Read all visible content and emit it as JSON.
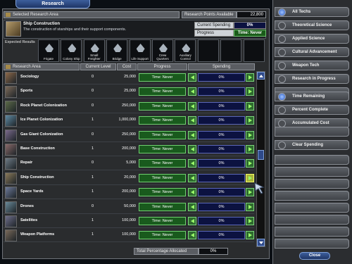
{
  "window": {
    "title": "Research"
  },
  "header": {
    "selected_area_label": "Selected Research Area",
    "rp_label": "Research Points Available",
    "rp_value": "22,800"
  },
  "selected": {
    "name": "Ship Construction",
    "description": "The construction of starships and their support components.",
    "current_spending_label": "Current Spending",
    "current_spending_value": "0%",
    "progress_label": "Progress",
    "progress_value": "Time: Never",
    "expected_results_label": "Expected Results",
    "results": [
      "Frigate",
      "Colony Ship",
      "Small Freighter",
      "Bridge",
      "Life Support",
      "Crew Quarters",
      "Auxiliary Control",
      "",
      "",
      ""
    ]
  },
  "table": {
    "headers": {
      "area": "Research Area",
      "level": "Current Level",
      "cost": "Cost",
      "progress": "Progress",
      "spending": "Spending"
    },
    "rows": [
      {
        "name": "Sociology",
        "level": "0",
        "cost": "25,000",
        "progress": "Time: Never",
        "spending": "0%"
      },
      {
        "name": "Sports",
        "level": "0",
        "cost": "25,000",
        "progress": "Time: Never",
        "spending": "0%"
      },
      {
        "name": "Rock Planet Colonization",
        "level": "0",
        "cost": "250,000",
        "progress": "Time: Never",
        "spending": "0%"
      },
      {
        "name": "Ice Planet Colonization",
        "level": "1",
        "cost": "1,000,000",
        "progress": "Time: Never",
        "spending": "0%"
      },
      {
        "name": "Gas Giant Colonization",
        "level": "0",
        "cost": "250,000",
        "progress": "Time: Never",
        "spending": "0%"
      },
      {
        "name": "Base Construction",
        "level": "1",
        "cost": "200,000",
        "progress": "Time: Never",
        "spending": "0%"
      },
      {
        "name": "Repair",
        "level": "0",
        "cost": "5,000",
        "progress": "Time: Never",
        "spending": "0%"
      },
      {
        "name": "Ship Construction",
        "level": "1",
        "cost": "20,000",
        "progress": "Time: Never",
        "spending": "0%"
      },
      {
        "name": "Space Yards",
        "level": "1",
        "cost": "200,000",
        "progress": "Time: Never",
        "spending": "0%"
      },
      {
        "name": "Drones",
        "level": "0",
        "cost": "50,000",
        "progress": "Time: Never",
        "spending": "0%"
      },
      {
        "name": "Satellites",
        "level": "1",
        "cost": "100,000",
        "progress": "Time: Never",
        "spending": "0%"
      },
      {
        "name": "Weapon Platforms",
        "level": "1",
        "cost": "100,000",
        "progress": "Time: Never",
        "spending": "0%"
      }
    ],
    "total_label": "Total Percentage Allocated",
    "total_value": "0%"
  },
  "sidebar": {
    "filters": [
      {
        "label": "All Techs",
        "selected": true
      },
      {
        "label": "Theoretical Science",
        "selected": false
      },
      {
        "label": "Applied Science",
        "selected": false
      },
      {
        "label": "Cultural Advancement",
        "selected": false
      },
      {
        "label": "Weapon Tech",
        "selected": false
      },
      {
        "label": "Research in Progress",
        "selected": false
      }
    ],
    "sorts": [
      {
        "label": "Time Remaining",
        "selected": true
      },
      {
        "label": "Percent Complete",
        "selected": false
      },
      {
        "label": "Accumulated Cost",
        "selected": false
      }
    ],
    "clear_spending": "Clear Spending",
    "close": "Close"
  },
  "colors": {
    "progress_green": "#195a1d",
    "spending_blue": "#0c1240",
    "accent": "#2f4a8a"
  }
}
